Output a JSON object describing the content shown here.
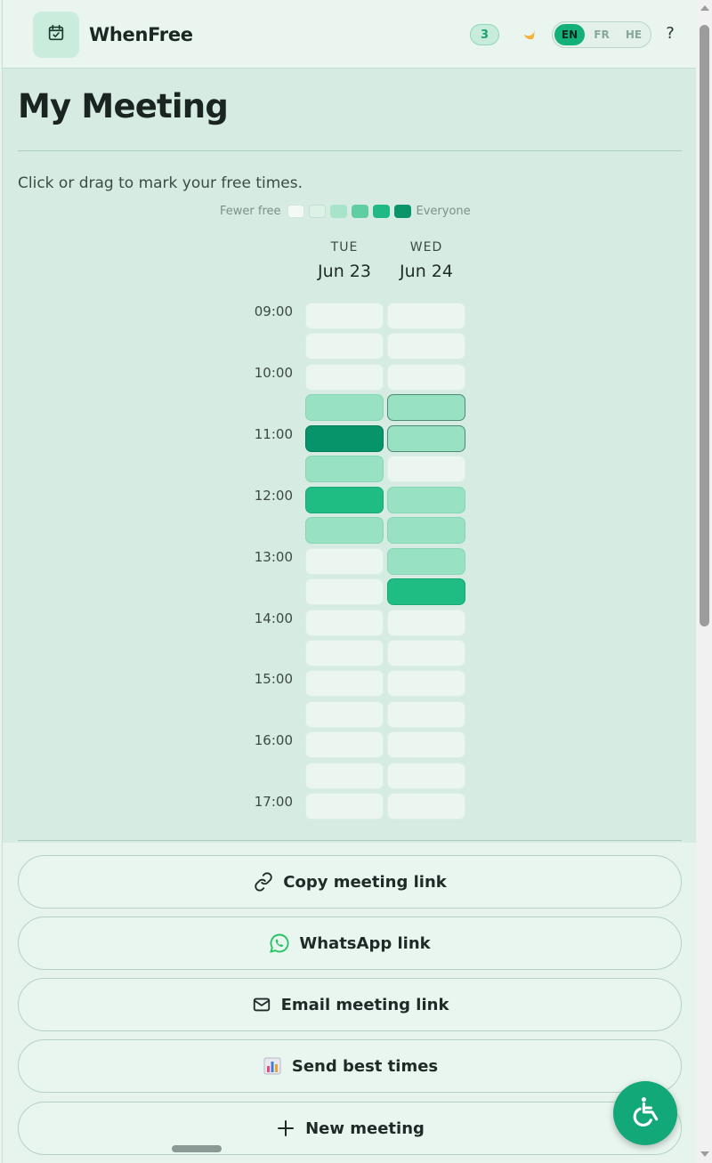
{
  "header": {
    "app_name": "WhenFree",
    "logo_icon": "calendar-check-icon",
    "participant_count": "3",
    "theme_icon": "moon-icon",
    "languages": [
      {
        "label": "EN",
        "active": true
      },
      {
        "label": "FR",
        "active": false
      },
      {
        "label": "HE",
        "active": false
      }
    ],
    "help_label": "?"
  },
  "main": {
    "title": "My Meeting",
    "instructions": "Click or drag to mark your free times.",
    "legend": {
      "left_label": "Fewer free",
      "right_label": "Everyone",
      "colors": [
        "#f3faf6",
        "#ddf1e7",
        "#a8e4c9",
        "#5fcfa2",
        "#1fb985",
        "#0b936a"
      ]
    },
    "days": [
      {
        "dow": "TUE",
        "date": "Jun 23"
      },
      {
        "dow": "WED",
        "date": "Jun 24"
      }
    ],
    "time_labels": [
      "09:00",
      "10:00",
      "11:00",
      "12:00",
      "13:00",
      "14:00",
      "15:00",
      "16:00",
      "17:00"
    ],
    "slot_levels": {
      "note_levels": "0 = nobody free, 1 = some, 2 = most, 3 = everyone",
      "tue": [
        0,
        0,
        0,
        1,
        3,
        1,
        2,
        1,
        0,
        0,
        0,
        0,
        0,
        0,
        0,
        0,
        0
      ],
      "wed": [
        0,
        0,
        0,
        1,
        1,
        0,
        1,
        1,
        1,
        2,
        0,
        0,
        0,
        0,
        0,
        0,
        0
      ],
      "wed_selected": [
        false,
        false,
        false,
        true,
        true,
        false,
        false,
        false,
        false,
        false,
        false,
        false,
        false,
        false,
        false,
        false,
        false
      ]
    }
  },
  "actions": [
    {
      "label": "Copy meeting link",
      "icon": "link-icon"
    },
    {
      "label": "WhatsApp link",
      "icon": "whatsapp-icon"
    },
    {
      "label": "Email meeting link",
      "icon": "mail-icon"
    },
    {
      "label": "Send best times",
      "icon": "bar-chart-icon"
    },
    {
      "label": "New meeting",
      "icon": "plus-icon"
    }
  ],
  "accessibility_icon": "wheelchair-icon",
  "colors": {
    "accent": "#12a877",
    "background": "#d6ebe1"
  }
}
